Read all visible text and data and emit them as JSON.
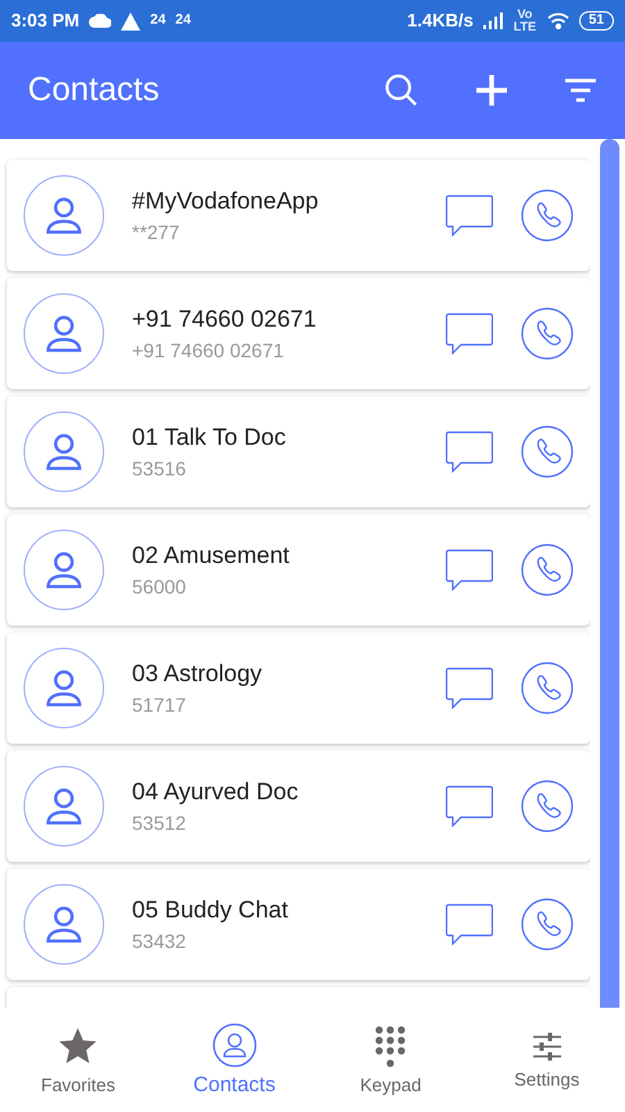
{
  "status_bar": {
    "time": "3:03 PM",
    "badges": [
      "24",
      "24"
    ],
    "speed": "1.4KB/s",
    "network": "Vo LTE",
    "battery": "51"
  },
  "app_bar": {
    "title": "Contacts"
  },
  "contacts": [
    {
      "name": "#MyVodafoneApp",
      "number": "**277"
    },
    {
      "name": "+91 74660 02671",
      "number": "+91 74660 02671"
    },
    {
      "name": "01 Talk To Doc",
      "number": "53516"
    },
    {
      "name": "02 Amusement",
      "number": "56000"
    },
    {
      "name": "03 Astrology",
      "number": "51717"
    },
    {
      "name": "04 Ayurved Doc",
      "number": "53512"
    },
    {
      "name": "05 Buddy Chat",
      "number": "53432"
    }
  ],
  "nav": [
    {
      "label": "Favorites",
      "kind": "star",
      "selected": false
    },
    {
      "label": "Contacts",
      "kind": "person",
      "selected": true
    },
    {
      "label": "Keypad",
      "kind": "dots",
      "selected": false
    },
    {
      "label": "Settings",
      "kind": "sliders",
      "selected": false
    }
  ]
}
